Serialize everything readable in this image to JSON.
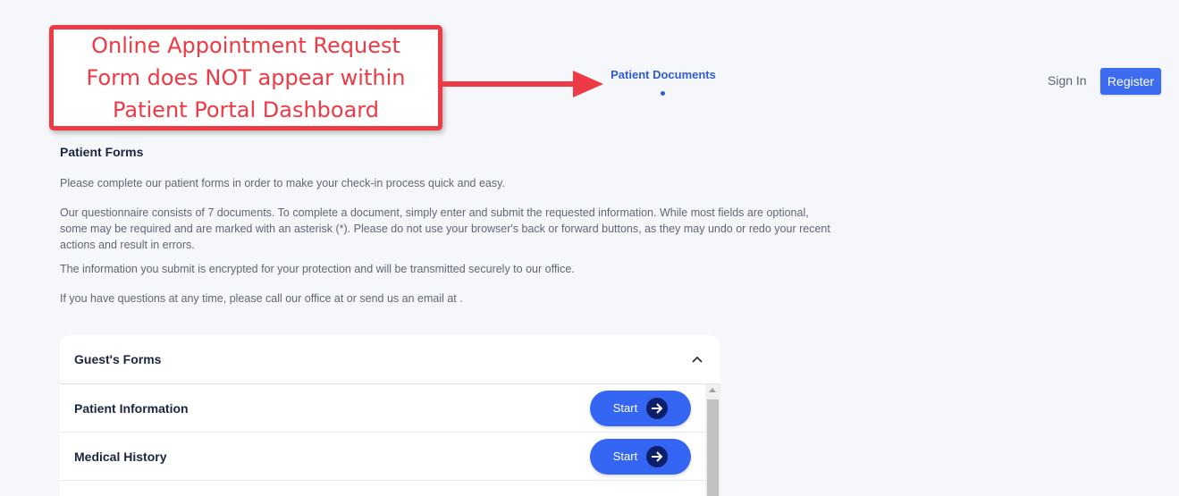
{
  "header": {
    "nav_tab": "Patient Documents",
    "sign_in": "Sign In",
    "register": "Register"
  },
  "annotation": {
    "text": "Online Appointment Request Form does NOT appear within Patient Portal Dashboard",
    "color": "#ee3a45"
  },
  "content": {
    "title": "Patient Forms",
    "paragraphs": [
      "Please complete our patient forms in order to make your check-in process quick and easy.",
      "Our questionnaire consists of 7 documents. To complete a document, simply enter and submit the requested information. While most fields are optional, some may be required and are marked with an asterisk (*). Please do not use your browser's back or forward buttons, as they may undo or redo your recent actions and result in errors.",
      "The information you submit is encrypted for your protection and will be transmitted securely to our office.",
      "If you have questions at any time, please call our office at or send us an email at ."
    ]
  },
  "forms_card": {
    "title": "Guest's Forms",
    "rows": [
      {
        "label": "Patient Information",
        "button": "Start"
      },
      {
        "label": "Medical History",
        "button": "Start"
      }
    ]
  },
  "colors": {
    "accent": "#3466f3",
    "nav_active": "#2f5bd8",
    "register_bg": "#3e6cf0"
  },
  "icons": [
    "chevron-up-icon",
    "arrow-right-icon",
    "callout-arrow-icon"
  ]
}
